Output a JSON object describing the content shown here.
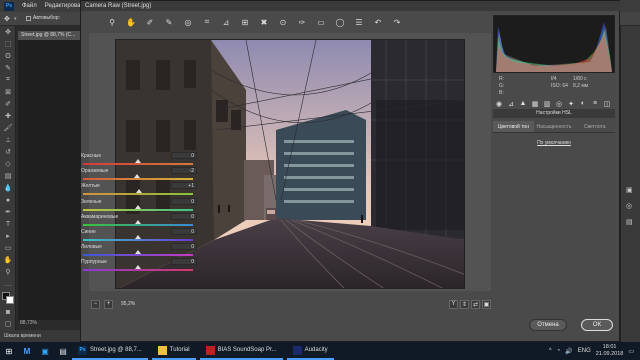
{
  "ps": {
    "menu": [
      "Файл",
      "Редактирование"
    ],
    "logo": "Ps",
    "autoselect_label": "Автовыбор:",
    "doc_tab": "Street.jpg @ 88,7% (С...",
    "zoom_status": "88,73%",
    "timeline_label": "Шкала времени"
  },
  "camera_raw": {
    "title": "Camera Raw (Street.jpg)",
    "zoom_value": "95,2%",
    "info": {
      "r_label": "R:",
      "g_label": "G:",
      "b_label": "B:",
      "aperture": "f/4",
      "shutter": "1/80 с",
      "iso": "ISO: 64",
      "focal": "8,2 мм"
    },
    "panel_title": "Настройки HSL",
    "subtabs": [
      "Цветовой тон",
      "Насыщенность",
      "Светлота"
    ],
    "default_link": "По умолчанию",
    "sliders": [
      {
        "label": "Красные",
        "value": "0",
        "pos": 0.5,
        "color_left": "#d43a3a",
        "color_right": "#d47a3a"
      },
      {
        "label": "Оранжевые",
        "value": "-2",
        "pos": 0.49,
        "color_left": "#d45a3a",
        "color_right": "#d4b43a"
      },
      {
        "label": "Желтые",
        "value": "+1",
        "pos": 0.505,
        "color_left": "#d4903a",
        "color_right": "#8ac43a"
      },
      {
        "label": "Зеленые",
        "value": "0",
        "pos": 0.5,
        "color_left": "#c4c43a",
        "color_right": "#3ac48a"
      },
      {
        "label": "Аквамариновые",
        "value": "0",
        "pos": 0.5,
        "color_left": "#3ac43a",
        "color_right": "#3a8ad4"
      },
      {
        "label": "Синие",
        "value": "0",
        "pos": 0.5,
        "color_left": "#3ac4c4",
        "color_right": "#6a3ad4"
      },
      {
        "label": "Лиловые",
        "value": "0",
        "pos": 0.5,
        "color_left": "#3a5ad4",
        "color_right": "#c43ac4"
      },
      {
        "label": "Пурпурные",
        "value": "0",
        "pos": 0.5,
        "color_left": "#8a3ad4",
        "color_right": "#d43a6a"
      }
    ],
    "cancel_label": "Отмена",
    "ok_label": "ОК"
  },
  "taskbar": {
    "apps": [
      {
        "label": "Street.jpg @ 88,7...",
        "icon": "Ps",
        "color": "#31a8ff",
        "bg": "#0d2a4d"
      },
      {
        "label": "Tutorial",
        "icon": "",
        "color": "#f0c040",
        "bg": "#f0c040"
      },
      {
        "label": "BIAS SoundSoap Pr...",
        "icon": "",
        "color": "#e03030",
        "bg": "#c02020"
      },
      {
        "label": "Audacity",
        "icon": "",
        "color": "#f08020",
        "bg": "#1a2a6a"
      }
    ],
    "lang": "ENG",
    "time": "18:01",
    "date": "21.09.2018"
  }
}
